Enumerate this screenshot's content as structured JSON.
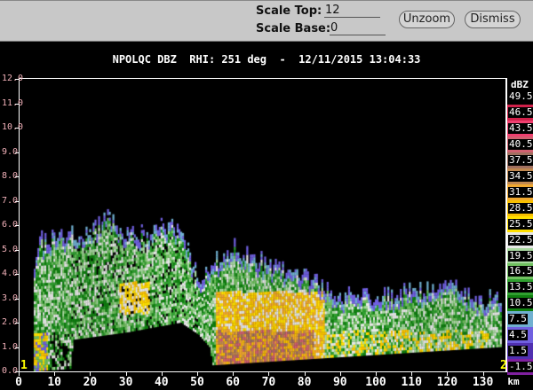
{
  "controls": {
    "scale_top_label": "Scale Top:",
    "scale_top_value": "12",
    "scale_base_label": "Scale Base:",
    "scale_base_value": "0",
    "unzoom_label": "Unzoom",
    "dismiss_label": "Dismiss"
  },
  "plot": {
    "title": "NPOLQC DBZ  RHI: 251 deg  -  12/11/2015 13:04:33",
    "y_ticks": [
      "12.0",
      "11.0",
      "10.0",
      "9.0",
      "8.0",
      "7.0",
      "6.0",
      "5.0",
      "4.0",
      "3.0",
      "2.0",
      "1.0",
      "0.0"
    ],
    "x_ticks": [
      "0",
      "10",
      "20",
      "30",
      "40",
      "50",
      "60",
      "70",
      "80",
      "90",
      "100",
      "110",
      "120",
      "130"
    ],
    "x_unit": "km",
    "marker_left": "1",
    "marker_right": "2"
  },
  "legend": {
    "unit": "dBZ",
    "items": [
      {
        "label": "49.5",
        "color": "#000000"
      },
      {
        "label": "46.5",
        "color": "#d0204a"
      },
      {
        "label": "43.5",
        "color": "#f04070"
      },
      {
        "label": "40.5",
        "color": "#d06070"
      },
      {
        "label": "37.5",
        "color": "#a07060"
      },
      {
        "label": "34.5",
        "color": "#c08850"
      },
      {
        "label": "31.5",
        "color": "#f0a830"
      },
      {
        "label": "28.5",
        "color": "#f8c000"
      },
      {
        "label": "25.5",
        "color": "#ffe000"
      },
      {
        "label": "22.5",
        "color": "#e8e8e8"
      },
      {
        "label": "19.5",
        "color": "#a8d8a0"
      },
      {
        "label": "16.5",
        "color": "#70c060"
      },
      {
        "label": "13.5",
        "color": "#30a030"
      },
      {
        "label": "10.5",
        "color": "#108010"
      },
      {
        "label": "7.5",
        "color": "#70b0d0"
      },
      {
        "label": "4.5",
        "color": "#7060e0"
      },
      {
        "label": "1.5",
        "color": "#5030b0"
      },
      {
        "label": "-1.5",
        "color": "#8020a0"
      }
    ]
  }
}
